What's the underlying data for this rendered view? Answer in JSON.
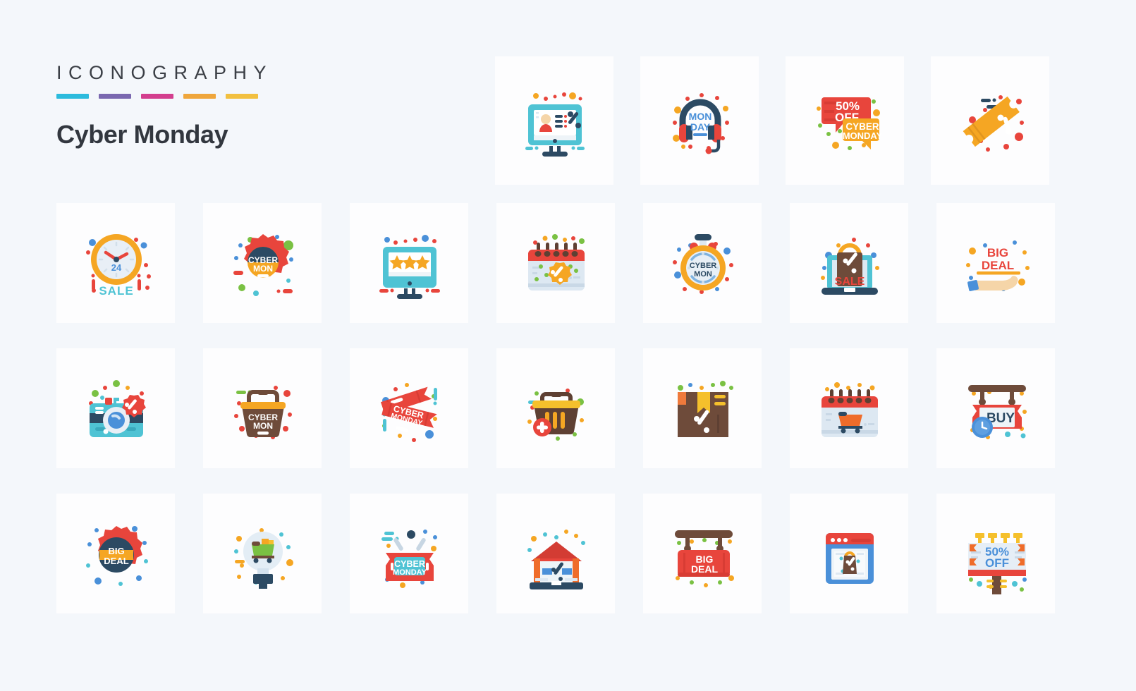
{
  "background_color": "#f4f7fb",
  "card_color": "#fdfdfe",
  "brand": {
    "title": "ICONOGRAPHY",
    "subtitle_word1": "Cyber",
    "subtitle_word2": "Monday",
    "rule_colors": [
      "#2cbbdd",
      "#7a68b0",
      "#d33e8e",
      "#efa63c",
      "#f2c040"
    ],
    "title_color": "#3b3f46",
    "subtitle_color": "#32373f"
  },
  "palette": {
    "red": "#e8453c",
    "red_dark": "#d83c34",
    "orange": "#f5a623",
    "yellow": "#f7c325",
    "teal": "#4fc3d4",
    "teal_dark": "#3aa9bd",
    "navy": "#2c4a63",
    "navy_dark": "#24455e",
    "brown": "#6e4b3a",
    "brown_light": "#8a5f49",
    "green": "#7ac143",
    "blue": "#4a90d9",
    "skin": "#f5d5a8",
    "lightblue_panel": "#dde8f2",
    "white": "#ffffff"
  },
  "icons": [
    {
      "id": "monitor-profile-discount",
      "name": "monitor with user profile and percent",
      "row": 1,
      "col": 4,
      "labels": []
    },
    {
      "id": "headphone-monday",
      "name": "headphones with MON DAY",
      "row": 1,
      "col": 5,
      "labels": [
        "MON",
        "DAY"
      ]
    },
    {
      "id": "chat-bubbles-50-off-cyber-monday",
      "name": "speech bubbles 50% OFF CYBER MONDAY",
      "row": 1,
      "col": 6,
      "labels": [
        "50%",
        "OFF",
        "CYBER",
        "MONDAY"
      ]
    },
    {
      "id": "discount-ticket-coupon",
      "name": "diagonal coupon ticket with percent",
      "row": 1,
      "col": 7,
      "labels": []
    },
    {
      "id": "clock-24-sale",
      "name": "clock 24 hour sale",
      "row": 2,
      "col": 1,
      "labels": [
        "24",
        "SALE"
      ]
    },
    {
      "id": "badge-cyber-mon",
      "name": "rosette badge CYBER MON",
      "row": 2,
      "col": 2,
      "labels": [
        "CYBER",
        "MON"
      ]
    },
    {
      "id": "monitor-stars-rating",
      "name": "monitor with three stars rating",
      "row": 2,
      "col": 3,
      "labels": []
    },
    {
      "id": "calendar-discount",
      "name": "calendar with percent badge",
      "row": 2,
      "col": 4,
      "labels": []
    },
    {
      "id": "stopwatch-cyber-mon",
      "name": "stopwatch CYBER MON",
      "row": 2,
      "col": 5,
      "labels": [
        "CYBER",
        "MON"
      ]
    },
    {
      "id": "laptop-bag-sale",
      "name": "laptop with shopping bag SALE",
      "row": 2,
      "col": 6,
      "labels": [
        "SALE"
      ]
    },
    {
      "id": "hand-big-deal",
      "name": "hand holding BIG DEAL",
      "row": 2,
      "col": 7,
      "labels": [
        "BIG",
        "DEAL"
      ]
    },
    {
      "id": "camera-discount",
      "name": "camera with percent badge",
      "row": 3,
      "col": 1,
      "labels": []
    },
    {
      "id": "basket-cyber-mon",
      "name": "shopping basket CYBER MON",
      "row": 3,
      "col": 2,
      "labels": [
        "CYBER",
        "MON"
      ]
    },
    {
      "id": "tickets-cyber-monday",
      "name": "red tickets CYBER MONDAY",
      "row": 3,
      "col": 3,
      "labels": [
        "CYBER",
        "MONDAY"
      ]
    },
    {
      "id": "basket-add-item",
      "name": "shopping basket with plus",
      "row": 3,
      "col": 4,
      "labels": []
    },
    {
      "id": "package-box-discount",
      "name": "package box with ribbon and percent",
      "row": 3,
      "col": 5,
      "labels": []
    },
    {
      "id": "calendar-cart",
      "name": "calendar with shopping cart",
      "row": 3,
      "col": 6,
      "labels": []
    },
    {
      "id": "hanging-sign-buy",
      "name": "hanging sign BUY with clock",
      "row": 3,
      "col": 7,
      "labels": [
        "BUY"
      ]
    },
    {
      "id": "rosette-big-deal",
      "name": "rosette badge BIG DEAL",
      "row": 4,
      "col": 1,
      "labels": [
        "BIG",
        "DEAL"
      ]
    },
    {
      "id": "lightbulb-cart-idea",
      "name": "lightbulb with shopping cart",
      "row": 4,
      "col": 2,
      "labels": []
    },
    {
      "id": "tag-cyber-monday",
      "name": "red tag CYBER MONDAY",
      "row": 4,
      "col": 3,
      "labels": [
        "CYBER",
        "MONDAY"
      ]
    },
    {
      "id": "shop-storefront-discount",
      "name": "shop storefront with percent",
      "row": 4,
      "col": 4,
      "labels": []
    },
    {
      "id": "hanging-sign-big-deal",
      "name": "hanging sign BIG DEAL",
      "row": 4,
      "col": 5,
      "labels": [
        "BIG",
        "DEAL"
      ]
    },
    {
      "id": "browser-shopping-bag",
      "name": "browser window with shopping bag",
      "row": 4,
      "col": 6,
      "labels": []
    },
    {
      "id": "billboard-50-off",
      "name": "billboard 50% OFF",
      "row": 4,
      "col": 7,
      "labels": [
        "50%",
        "OFF"
      ]
    }
  ],
  "labels": {
    "monday_top": "MON",
    "monday_bottom": "DAY",
    "fifty": "50%",
    "off": "OFF",
    "cyber": "CYBER",
    "monday": "MONDAY",
    "mon": "MON",
    "twentyfour": "24",
    "sale": "SALE",
    "big": "BIG",
    "deal": "DEAL",
    "buy": "BUY"
  }
}
